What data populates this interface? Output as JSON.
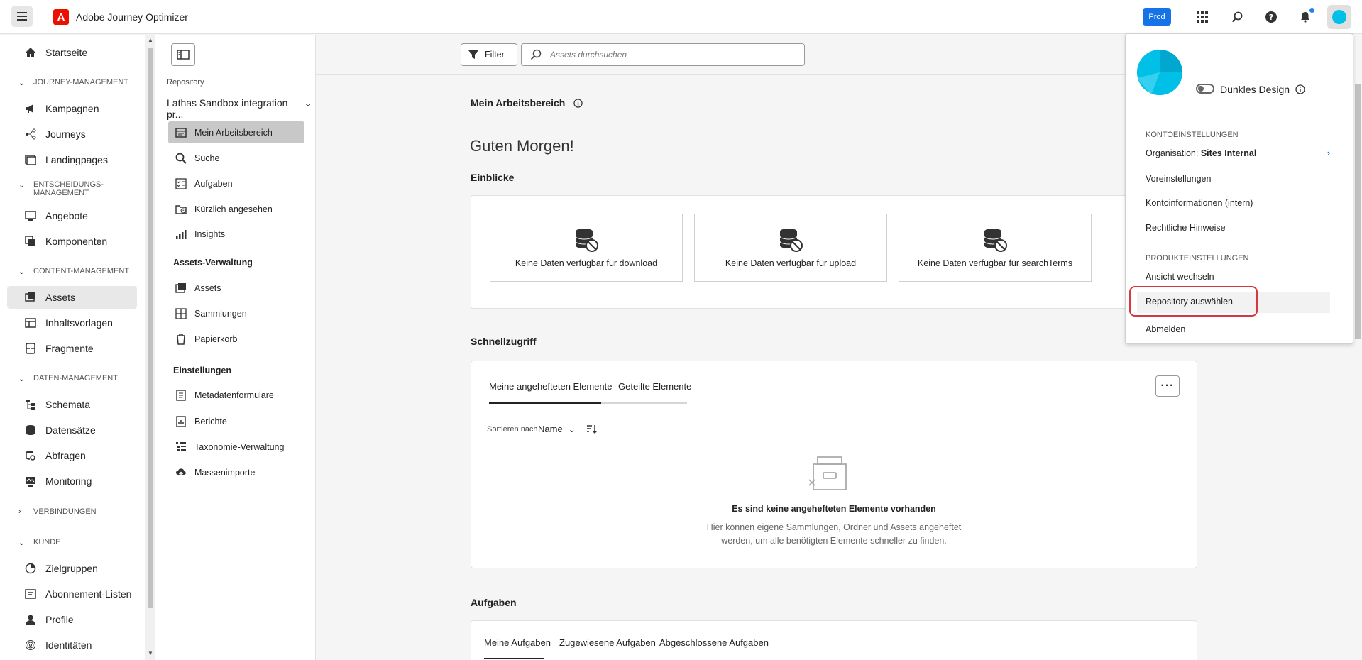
{
  "app": {
    "title": "Adobe Journey Optimizer",
    "logo_letter": "A",
    "env_badge": "Prod"
  },
  "leftnav": {
    "home": "Startseite",
    "sections": [
      {
        "label": "JOURNEY-MANAGEMENT",
        "items": [
          "Kampagnen",
          "Journeys",
          "Landingpages"
        ]
      },
      {
        "label": "ENTSCHEIDUNGS-MANAGEMENT",
        "items": [
          "Angebote",
          "Komponenten"
        ]
      },
      {
        "label": "CONTENT-MANAGEMENT",
        "items": [
          "Assets",
          "Inhaltsvorlagen",
          "Fragmente"
        ]
      },
      {
        "label": "DATEN-MANAGEMENT",
        "items": [
          "Schemata",
          "Datensätze",
          "Abfragen",
          "Monitoring"
        ]
      },
      {
        "label": "VERBINDUNGEN",
        "items": []
      },
      {
        "label": "KUNDE",
        "items": [
          "Zielgruppen",
          "Abonnement-Listen",
          "Profile",
          "Identitäten"
        ]
      }
    ]
  },
  "repo": {
    "label": "Repository",
    "selected": "Lathas Sandbox integration pr...",
    "items": [
      "Mein Arbeitsbereich",
      "Suche",
      "Aufgaben",
      "Kürzlich angesehen",
      "Insights"
    ],
    "assets_heading": "Assets-Verwaltung",
    "assets_items": [
      "Assets",
      "Sammlungen",
      "Papierkorb"
    ],
    "settings_heading": "Einstellungen",
    "settings_items": [
      "Metadatenformulare",
      "Berichte",
      "Taxonomie-Verwaltung",
      "Massenimporte"
    ]
  },
  "toolbar": {
    "filter_label": "Filter",
    "search_placeholder": "Assets durchsuchen"
  },
  "main": {
    "workspace_title": "Mein Arbeitsbereich",
    "greeting": "Guten Morgen!",
    "insights_title": "Einblicke",
    "insights": [
      "Keine Daten verfügbar für download",
      "Keine Daten verfügbar für upload",
      "Keine Daten verfügbar für searchTerms"
    ],
    "quick_title": "Schnellzugriff",
    "quick_tabs": [
      "Meine angehefteten Elemente",
      "Geteilte Elemente"
    ],
    "sort_label": "Sortieren nach",
    "sort_value": "Name",
    "empty_title": "Es sind keine angehefteten Elemente vorhanden",
    "empty_line1": "Hier können eigene Sammlungen, Ordner und Assets angeheftet",
    "empty_line2": "werden, um alle benötigten Elemente schneller zu finden.",
    "tasks_title": "Aufgaben",
    "task_tabs": [
      "Meine Aufgaben",
      "Zugewiesene Aufgaben",
      "Abgeschlossene Aufgaben"
    ]
  },
  "profile_menu": {
    "dark_mode": "Dunkles Design",
    "account_heading": "KONTOEINSTELLUNGEN",
    "org_label": "Organisation:",
    "org_value": "Sites Internal",
    "preferences": "Voreinstellungen",
    "account_info": "Kontoinformationen (intern)",
    "legal": "Rechtliche Hinweise",
    "product_heading": "PRODUKTEINSTELLUNGEN",
    "switch_view": "Ansicht wechseln",
    "select_repo": "Repository auswählen",
    "logout": "Abmelden"
  },
  "colors": {
    "accent": "#1473e6",
    "highlight_border": "#d7373f",
    "avatar": "#00c0e8"
  }
}
